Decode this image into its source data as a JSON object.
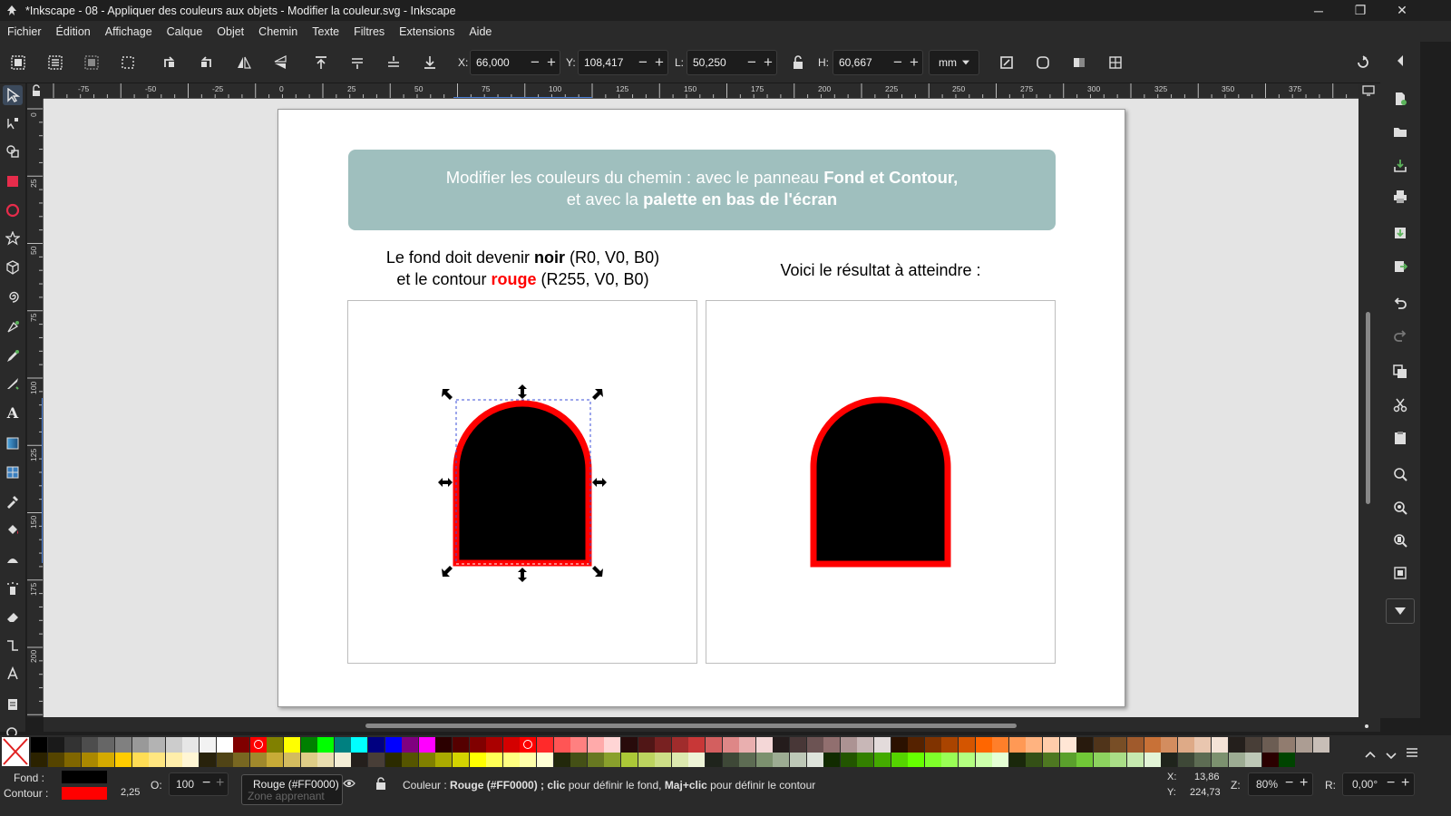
{
  "window": {
    "title": "*Inkscape - 08 - Appliquer des couleurs aux objets - Modifier la couleur.svg - Inkscape",
    "minimize": "─",
    "maximize": "❐",
    "close": "✕"
  },
  "menu": [
    "Fichier",
    "Édition",
    "Affichage",
    "Calque",
    "Objet",
    "Chemin",
    "Texte",
    "Filtres",
    "Extensions",
    "Aide"
  ],
  "toolcontrols": {
    "x_label": "X:",
    "x_value": "66,000",
    "y_label": "Y:",
    "y_value": "108,417",
    "w_label": "L:",
    "w_value": "50,250",
    "h_label": "H:",
    "h_value": "60,667",
    "unit": "mm"
  },
  "ruler": {
    "h_ticks": [
      "-75",
      "-50",
      "-25",
      "0",
      "25",
      "50",
      "75",
      "100",
      "125",
      "150",
      "175",
      "200",
      "225",
      "250",
      "275",
      "300",
      "325",
      "350",
      "375"
    ],
    "v_ticks": [
      "0",
      "25",
      "50",
      "75",
      "100",
      "125",
      "150",
      "175",
      "200"
    ]
  },
  "document": {
    "banner_line1_a": "Modifier les couleurs du chemin : avec le panneau ",
    "banner_line1_b": "Fond et Contour,",
    "banner_line2_a": "et avec la ",
    "banner_line2_b": "palette en bas de l'écran",
    "left_cap_line1_a": "Le fond doit devenir ",
    "left_cap_line1_b": "noir",
    "left_cap_line1_c": " (R0, V0, B0)",
    "left_cap_line2_a": "et le contour ",
    "left_cap_line2_b": "rouge",
    "left_cap_line2_c": " (R255, V0, B0)",
    "right_cap": "Voici le résultat à atteindre :",
    "shape_fill": "#000000",
    "shape_stroke": "#ff0000"
  },
  "palette": {
    "colors": [
      "#000000",
      "#1a1a1a",
      "#333333",
      "#4d4d4d",
      "#666666",
      "#808080",
      "#999999",
      "#b3b3b3",
      "#cccccc",
      "#e6e6e6",
      "#f2f2f2",
      "#ffffff",
      "#800000",
      "#ff0000",
      "#808000",
      "#ffff00",
      "#008000",
      "#00ff00",
      "#008080",
      "#00ffff",
      "#000080",
      "#0000ff",
      "#800080",
      "#ff00ff",
      "#2b0000",
      "#550000",
      "#800000",
      "#aa0000",
      "#d40000",
      "#ff0000",
      "#ff2a2a",
      "#ff5555",
      "#ff8080",
      "#ffaaaa",
      "#ffd5d5",
      "#280b0b",
      "#501616",
      "#782121",
      "#a02c2c",
      "#c83737",
      "#d35f5f",
      "#de8787",
      "#e9afaf",
      "#f4d7d7",
      "#241c1c",
      "#483737",
      "#6c5353",
      "#916f6f",
      "#ac9393",
      "#c8b7b7",
      "#e3dbdb",
      "#2b1100",
      "#552200",
      "#803300",
      "#aa4400",
      "#d45500",
      "#ff6600",
      "#ff7f2a",
      "#ff9955",
      "#ffb380",
      "#ffccaa",
      "#ffe6d5",
      "#281a0d",
      "#50341a",
      "#784e26",
      "#a05a2c",
      "#c87137",
      "#d38d5f",
      "#deaa87",
      "#e9c6af",
      "#f4e3d7",
      "#241f1c",
      "#483e37",
      "#6c5d53",
      "#917c6f",
      "#ac9d93",
      "#c8beb7"
    ],
    "colors_row2": [
      "#2b2200",
      "#554400",
      "#806600",
      "#aa8800",
      "#d4aa00",
      "#ffcc00",
      "#ffdd55",
      "#ffe680",
      "#ffeeaa",
      "#fff6d5",
      "#28220b",
      "#504416",
      "#786721",
      "#a0892c",
      "#c8ab37",
      "#d3bc5f",
      "#decd87",
      "#e9ddaf",
      "#f4eed7",
      "#241f1c",
      "#483e37",
      "#2b2b00",
      "#555500",
      "#808000",
      "#aaaa00",
      "#d4d400",
      "#ffff00",
      "#ffff55",
      "#ffff80",
      "#ffffaa",
      "#ffffd5",
      "#22280b",
      "#445016",
      "#677821",
      "#89a02c",
      "#abc837",
      "#bcd35f",
      "#cdde87",
      "#dde9af",
      "#eef4d7",
      "#1f241c",
      "#3e4837",
      "#5d6c53",
      "#7c916f",
      "#9dac93",
      "#bec8b7",
      "#dee3db",
      "#112b00",
      "#225500",
      "#338000",
      "#44aa00",
      "#55d400",
      "#66ff00",
      "#7fff2a",
      "#99ff55",
      "#b3ff80",
      "#ccffaa",
      "#e5ffd5",
      "#1a280b",
      "#345016",
      "#4e7821",
      "#5aa02c",
      "#71c837",
      "#8dd35f",
      "#aade87",
      "#c6e9af",
      "#e3f4d7",
      "#1f241c",
      "#3e4837",
      "#5d6c53",
      "#7c916f",
      "#9dac93",
      "#bec8b7",
      "#2b0000",
      "#004400"
    ]
  },
  "status": {
    "fill_label": "Fond :",
    "stroke_label": "Contour :",
    "fill_color": "#000000",
    "stroke_color": "#ff0000",
    "stroke_width": "2,25",
    "opacity_label": "O:",
    "opacity_value": "100",
    "tooltip": "Rouge (#FF0000)",
    "layer_hint": "Zone apprenant",
    "message_a": "Couleur : ",
    "message_b": "Rouge (#FF0000) ; clic",
    "message_c": " pour définir le fond, ",
    "message_d": "Maj+clic",
    "message_e": " pour définir le contour",
    "cursor_x_label": "X:",
    "cursor_x": "13,86",
    "cursor_y_label": "Y:",
    "cursor_y": "224,73",
    "zoom_label": "Z:",
    "zoom": "80%",
    "rotation_label": "R:",
    "rotation": "0,00°"
  }
}
